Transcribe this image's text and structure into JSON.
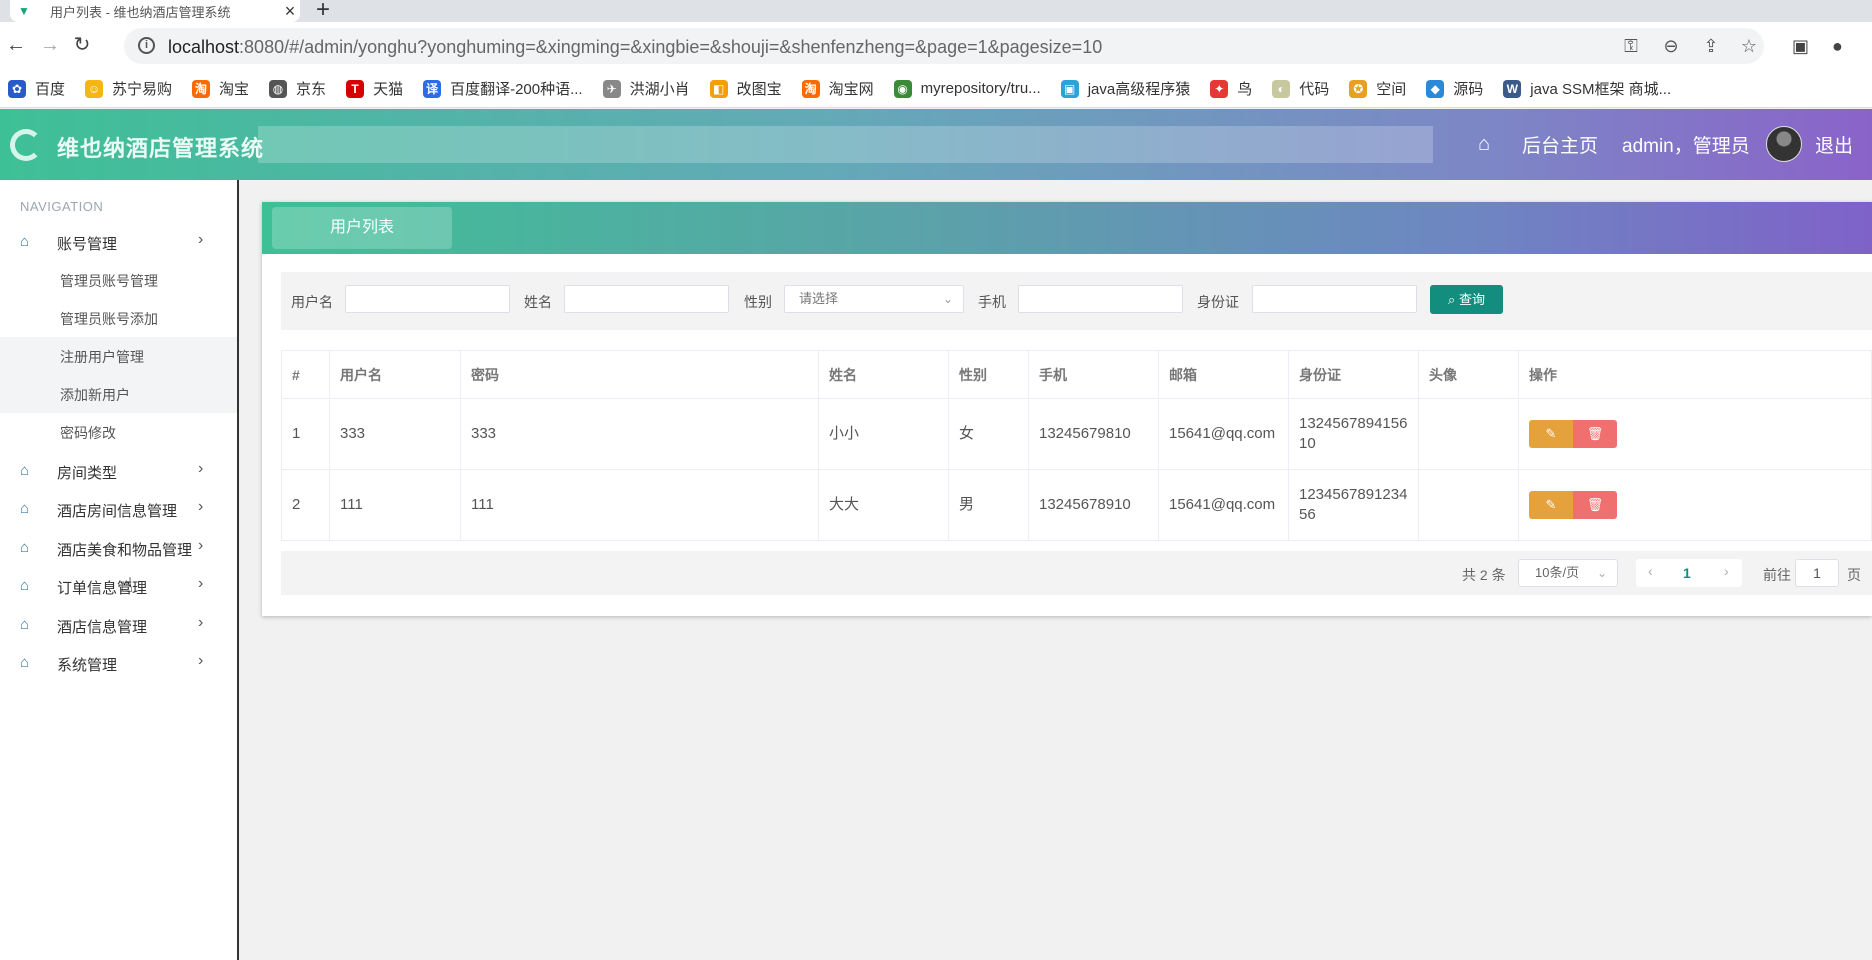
{
  "browser": {
    "tab_title": "用户列表 - 维也纳酒店管理系统",
    "url_host": "localhost",
    "url_rest": ":8080/#/admin/yonghu?yonghuming=&xingming=&xingbie=&shouji=&shenfenzheng=&page=1&pagesize=10",
    "bookmarks": [
      {
        "label": "百度",
        "icon": "baidu-icon",
        "color": "#2a5ac9"
      },
      {
        "label": "苏宁易购",
        "icon": "suning-icon",
        "color": "#f5b614"
      },
      {
        "label": "淘宝",
        "icon": "taobao-icon",
        "color": "#ff6a00"
      },
      {
        "label": "京东",
        "icon": "globe-icon",
        "color": "#555555"
      },
      {
        "label": "天猫",
        "icon": "tmall-icon",
        "color": "#d60000"
      },
      {
        "label": "百度翻译-200种语...",
        "icon": "translate-icon",
        "color": "#2a6de6"
      },
      {
        "label": "洪湖小肖",
        "icon": "bird-icon",
        "color": "#888888"
      },
      {
        "label": "改图宝",
        "icon": "gaitubao-icon",
        "color": "#f59e0b"
      },
      {
        "label": "淘宝网",
        "icon": "taobao-icon",
        "color": "#ff6a00"
      },
      {
        "label": "myrepository/tru...",
        "icon": "chrome-icon",
        "color": "#3a8a3a"
      },
      {
        "label": "java高级程序猿",
        "icon": "bilibili-icon",
        "color": "#2aa3d9"
      },
      {
        "label": "鸟",
        "icon": "bird-red-icon",
        "color": "#e53935"
      },
      {
        "label": "代码",
        "icon": "code-icon",
        "color": "#c8c8a0"
      },
      {
        "label": "空间",
        "icon": "qzone-icon",
        "color": "#e8a020"
      },
      {
        "label": "源码",
        "icon": "docker-icon",
        "color": "#2a8ad9"
      },
      {
        "label": "java SSM框架 商城...",
        "icon": "wordpress-icon",
        "color": "#3a5a8a"
      }
    ]
  },
  "header": {
    "app_title": "维也纳酒店管理系统",
    "home_label": "后台主页",
    "user_label": "admin，管理员",
    "logout_label": "退出"
  },
  "sidebar": {
    "nav_title": "NAVIGATION",
    "groups": [
      {
        "label": "账号管理"
      },
      {
        "label": "房间类型"
      },
      {
        "label": "酒店房间信息管理"
      },
      {
        "label": "酒店美食和物品管理"
      },
      {
        "label": "订单信息管理"
      },
      {
        "label": "酒店信息管理"
      },
      {
        "label": "系统管理"
      }
    ],
    "sub_items": [
      {
        "label": "管理员账号管理"
      },
      {
        "label": "管理员账号添加"
      },
      {
        "label": "注册用户管理"
      },
      {
        "label": "添加新用户"
      },
      {
        "label": "密码修改"
      }
    ]
  },
  "panel": {
    "tab_label": "用户列表",
    "search": {
      "username_label": "用户名",
      "name_label": "姓名",
      "gender_label": "性别",
      "gender_placeholder": "请选择",
      "phone_label": "手机",
      "idcard_label": "身份证",
      "button_label": "⌕ 查询"
    },
    "table": {
      "columns": [
        "#",
        "用户名",
        "密码",
        "姓名",
        "性别",
        "手机",
        "邮箱",
        "身份证",
        "头像",
        "操作"
      ],
      "rows": [
        {
          "no": "1",
          "username": "333",
          "password": "333",
          "name": "小小",
          "gender": "女",
          "phone": "13245679810",
          "email": "15641@qq.com",
          "idcard": "132456789415610",
          "idcard_l1": "1324567894156",
          "idcard_l2": "10",
          "avatar": ""
        },
        {
          "no": "2",
          "username": "111",
          "password": "111",
          "name": "大大",
          "gender": "男",
          "phone": "13245678910",
          "email": "15641@qq.com",
          "idcard": "123456789123456",
          "idcard_l1": "1234567891234",
          "idcard_l2": "56",
          "avatar": ""
        }
      ],
      "edit_icon": "✎",
      "delete_icon": "🗑"
    },
    "pagination": {
      "total": "共 2 条",
      "page_size": "10条/页",
      "current_page": "1",
      "goto_label": "前往",
      "goto_value": "1",
      "page_suffix": "页"
    }
  },
  "colors": {
    "accent": "#138e7e",
    "edit": "#e5a13c",
    "delete": "#f07070",
    "active_menu": "#2f7fb5"
  }
}
